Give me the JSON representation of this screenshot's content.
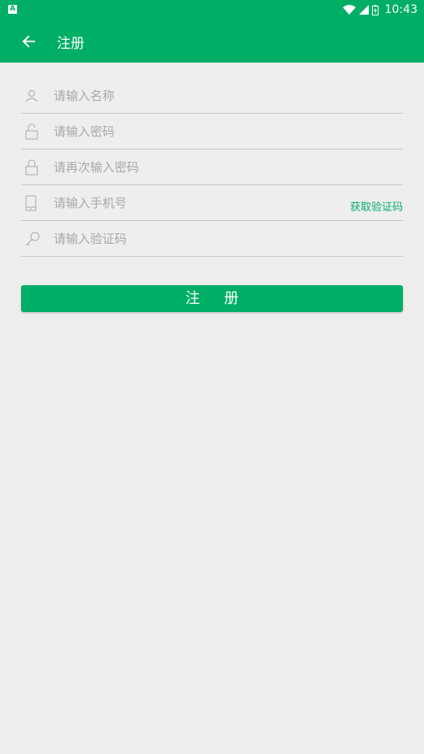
{
  "status_bar": {
    "time": "10:43",
    "left_icon": "A"
  },
  "app_bar": {
    "title": "注册",
    "back_icon": "arrow-back"
  },
  "form": {
    "name_placeholder": "请输入名称",
    "password_placeholder": "请输入密码",
    "confirm_password_placeholder": "请再次输入密码",
    "phone_placeholder": "请输入手机号",
    "code_placeholder": "请输入验证码",
    "get_code_label": "获取验证码",
    "register_label": "注 册"
  },
  "colors": {
    "primary": "#00ae66",
    "background": "#eeeeee",
    "divider": "#c8c8c8",
    "placeholder": "#a8a8a8"
  }
}
